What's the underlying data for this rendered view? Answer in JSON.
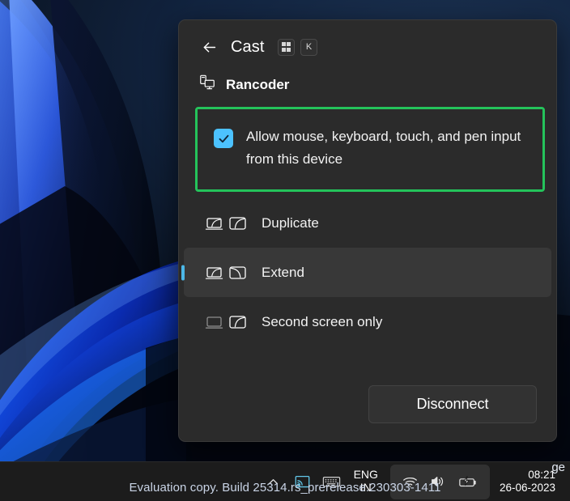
{
  "panel": {
    "back_icon": "back-arrow-icon",
    "title": "Cast",
    "shortcut_keys": [
      "win-logo-icon",
      "K"
    ],
    "device": {
      "icon": "pc-and-monitor-icon",
      "name": "Rancoder"
    },
    "input_checkbox": {
      "checked": true,
      "label": "Allow mouse, keyboard, touch, and pen input from this device",
      "highlight_color": "#24c35b"
    },
    "options": [
      {
        "label": "Duplicate",
        "icon": "duplicate-displays-icon",
        "selected": false
      },
      {
        "label": "Extend",
        "icon": "extend-displays-icon",
        "selected": true
      },
      {
        "label": "Second screen only",
        "icon": "second-screen-only-icon",
        "selected": false
      }
    ],
    "footer": {
      "disconnect_label": "Disconnect"
    },
    "accent_color": "#4cb8e8",
    "checkbox_color": "#4cc2ff",
    "background_color": "#2b2b2b"
  },
  "desktop": {
    "watermark": "Evaluation copy. Build 25314.rs_prerelease.230303-1411",
    "watermark_secondary": "ge"
  },
  "taskbar": {
    "hidden_icons_label": "chevron-up-icon",
    "cast_icon": "cast-active-icon",
    "keyboard_icon": "touch-keyboard-icon",
    "language": {
      "line1": "ENG",
      "line2": "IN"
    },
    "tray": {
      "wifi_icon": "wifi-icon",
      "volume_icon": "volume-icon",
      "battery_icon": "battery-charging-icon"
    },
    "clock": {
      "time": "08:21",
      "date": "26-06-2023"
    },
    "cast_icon_color": "#62c6e8"
  }
}
